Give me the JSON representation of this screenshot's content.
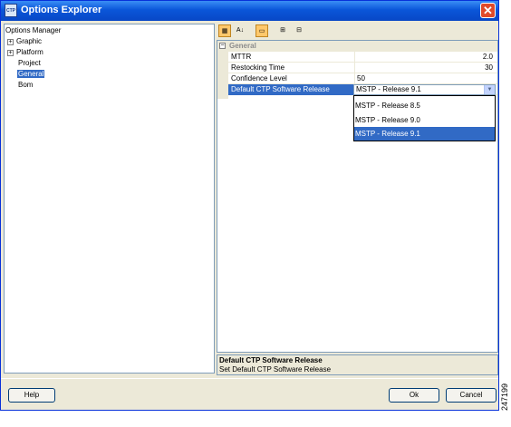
{
  "window": {
    "title": "Options Explorer",
    "icon": "app-options-icon",
    "close_label": "✕"
  },
  "tree": {
    "root": "Options Manager",
    "items": [
      {
        "label": "Graphic",
        "expandable": true
      },
      {
        "label": "Platform",
        "expandable": true
      },
      {
        "label": "Project",
        "expandable": false
      },
      {
        "label": "General",
        "expandable": false,
        "selected": true
      },
      {
        "label": "Bom",
        "expandable": false
      }
    ]
  },
  "toolbar": {
    "buttons": [
      "categorized-icon",
      "sort-alphabetical-icon",
      "property-pages-icon",
      "expand-all-icon",
      "collapse-all-icon"
    ]
  },
  "grid": {
    "section": "General",
    "section_toggle": "−",
    "properties": [
      {
        "name": "MTTR",
        "value": "2.0"
      },
      {
        "name": "Restocking Time",
        "value": "30"
      },
      {
        "name": "Confidence Level",
        "value": "50"
      },
      {
        "name": "Default CTP Software Release",
        "value": "MSTP - Release 9.1",
        "selected": true
      }
    ],
    "dropdown_options": [
      "MSTP - Release 8.5",
      "MSTP - Release 9.0",
      "MSTP - Release 9.1"
    ],
    "selected_option": "MSTP - Release 9.1"
  },
  "description": {
    "title": "Default CTP Software Release",
    "text": "Set Default CTP Software Release"
  },
  "buttons": {
    "help": "Help",
    "ok": "Ok",
    "cancel": "Cancel"
  },
  "figure_id": "247199",
  "colors": {
    "selection": "#316ac5",
    "title_bar": "#0a56d9",
    "close": "#e04a2a"
  }
}
